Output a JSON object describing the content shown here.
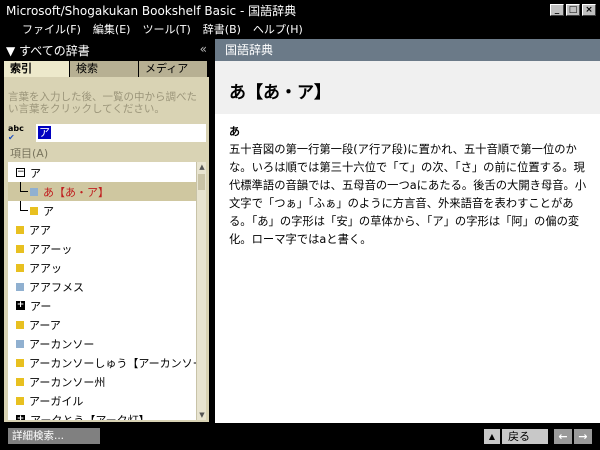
{
  "window": {
    "title": "Microsoft/Shogakukan Bookshelf Basic - 国語辞典",
    "buttons": {
      "minimize": "_",
      "maximize": "□",
      "close": "×"
    }
  },
  "menu": [
    "ファイル(F)",
    "編集(E)",
    "ツール(T)",
    "辞書(B)",
    "ヘルプ(H)"
  ],
  "left_panel": {
    "header": "▼ すべての辞書",
    "collapse_icon": "«",
    "tabs": [
      "索引",
      "検索",
      "メディア"
    ],
    "hint": "言葉を入力した後、一覧の中から調べたい言葉をクリックしてください。",
    "search_icon_text": "abc",
    "search_value": "ア",
    "items_label": "項目(A)",
    "list": [
      {
        "text": "ア",
        "type": "minus",
        "indent": 0
      },
      {
        "text": "あ【あ・ア】",
        "type": "blue",
        "indent": 1,
        "selected": true
      },
      {
        "text": "ア",
        "type": "yellow",
        "indent": 1
      },
      {
        "text": "アア",
        "type": "yellow",
        "indent": 0
      },
      {
        "text": "アアーッ",
        "type": "yellow",
        "indent": 0
      },
      {
        "text": "アアッ",
        "type": "yellow",
        "indent": 0
      },
      {
        "text": "アアフメス",
        "type": "blue",
        "indent": 0
      },
      {
        "text": "アー",
        "type": "plus",
        "indent": 0
      },
      {
        "text": "アーア",
        "type": "yellow",
        "indent": 0
      },
      {
        "text": "アーカンソー",
        "type": "blue",
        "indent": 0
      },
      {
        "text": "アーカンソーしゅう【アーカンソー州",
        "type": "yellow",
        "indent": 0
      },
      {
        "text": "アーカンソー州",
        "type": "yellow",
        "indent": 0
      },
      {
        "text": "アーガイル",
        "type": "yellow",
        "indent": 0
      },
      {
        "text": "アークとう【アーク灯】",
        "type": "plus",
        "indent": 0
      }
    ]
  },
  "right_panel": {
    "header": "国語辞典",
    "headword": "あ【あ・ア】",
    "subhead": "あ",
    "definition": "五十音図の第一行第一段(ア行ア段)に置かれ、五十音順で第一位のかな。いろは順では第三十六位で「て」の次、「さ」の前に位置する。現代標準語の音韻では、五母音の一つaにあたる。後舌の大開き母音。小文字で「つぁ」「ふぁ」のように方言音、外来語音を表わすことがある。「あ」の字形は「安」の草体から、「ア」の字形は「阿」の偏の変化。ローマ字ではaと書く。"
  },
  "status": {
    "detail_search": "詳細検索...",
    "up": "▲",
    "back": "戻る",
    "prev": "←",
    "next": "→"
  },
  "colors": {
    "chrome": "#000000",
    "left_panel_bg": "#d9d3b4",
    "active_tab": "#ede9cb",
    "right_header": "#6b7a88",
    "selected_text": "#c02020",
    "yellow_square": "#e8c020",
    "blue_square": "#90b0d0"
  }
}
